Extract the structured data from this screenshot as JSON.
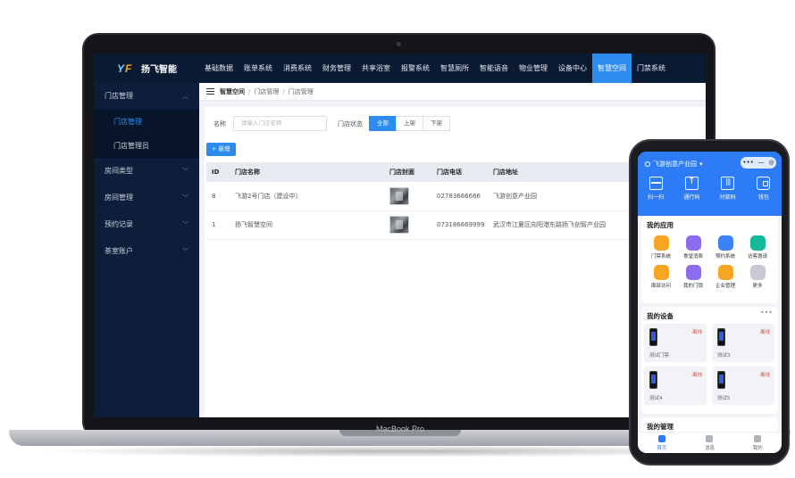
{
  "colors": {
    "accent": "#2d8cf0",
    "topbar": "#0b1a33",
    "sidebar": "#0e1e3a",
    "phone_header": "#2d7cf6",
    "offline": "#f0483e"
  },
  "laptop": {
    "brand": "MacBook Pro"
  },
  "app": {
    "logo_text": "扬飞智能",
    "nav": [
      "基础数据",
      "账单系统",
      "消费系统",
      "财务管理",
      "共享浴室",
      "报警系统",
      "智慧厕所",
      "智能语音",
      "物业管理",
      "设备中心",
      "智慧空间",
      "门禁系统"
    ],
    "nav_active_index": 10,
    "sidebar": {
      "groups": [
        {
          "label": "门店管理",
          "icon": "chevron-up-icon",
          "children": [
            "门店管理",
            "门店管理员"
          ]
        },
        {
          "label": "房间类型",
          "icon": "chevron-down-icon"
        },
        {
          "label": "房间管理",
          "icon": "chevron-down-icon"
        },
        {
          "label": "预约记录",
          "icon": "chevron-down-icon"
        },
        {
          "label": "茶室账户",
          "icon": "chevron-down-icon"
        }
      ]
    },
    "breadcrumb": [
      "智慧空间",
      "门店管理",
      "门店管理"
    ],
    "filters": {
      "name_label": "名称",
      "name_placeholder": "请输入门店名称",
      "status_label": "门店状态",
      "status_options": [
        "全部",
        "上架",
        "下架"
      ],
      "status_selected": 0
    },
    "add_button": "+ 新增",
    "table": {
      "headers": [
        "ID",
        "门店名称",
        "门店封面",
        "门店电话",
        "门店地址"
      ],
      "rows": [
        {
          "id": "8",
          "name": "飞游2号门店（建设中）",
          "phone": "02783666666",
          "address": "飞游创意产业园"
        },
        {
          "id": "1",
          "name": "扬飞智慧空间",
          "phone": "073186669999",
          "address": "武汉市江夏区向阳港东路扬飞创智产业园"
        }
      ]
    }
  },
  "phone": {
    "header_title": "飞游创意产业园",
    "capsule": [
      "•••",
      "—",
      "◎"
    ],
    "quick_actions": [
      {
        "label": "扫一扫",
        "icon": "scan-icon"
      },
      {
        "label": "通行码",
        "icon": "upload-icon"
      },
      {
        "label": "付款码",
        "icon": "barcode-icon"
      },
      {
        "label": "钱包",
        "icon": "wallet-icon"
      }
    ],
    "apps_title": "我的应用",
    "apps": [
      {
        "label": "门禁系统",
        "icon": "door-access-icon",
        "color": "#f6a623"
      },
      {
        "label": "食堂消费",
        "icon": "canteen-icon",
        "color": "#8e6cf0"
      },
      {
        "label": "预约系统",
        "icon": "booking-icon",
        "color": "#3b82f6"
      },
      {
        "label": "访客邀请",
        "icon": "visitor-icon",
        "color": "#16b99c"
      },
      {
        "label": "面部访问",
        "icon": "face-access-icon",
        "color": "#f6a623"
      },
      {
        "label": "我的门锁",
        "icon": "lock-icon",
        "color": "#8e6cf0"
      },
      {
        "label": "企业管理",
        "icon": "company-icon",
        "color": "#f6a623"
      },
      {
        "label": "更多",
        "icon": "more-icon",
        "color": "#c7cbd1"
      }
    ],
    "devices_title": "我的设备",
    "devices": [
      {
        "name": "测试门禁",
        "status": "离线"
      },
      {
        "name": "测试3",
        "status": "离线"
      },
      {
        "name": "测试4",
        "status": "离线"
      },
      {
        "name": "测试5",
        "status": "离线"
      }
    ],
    "manage_title": "我的管理",
    "tabs": [
      "首页",
      "消息",
      "我的"
    ],
    "tab_active_index": 0
  }
}
